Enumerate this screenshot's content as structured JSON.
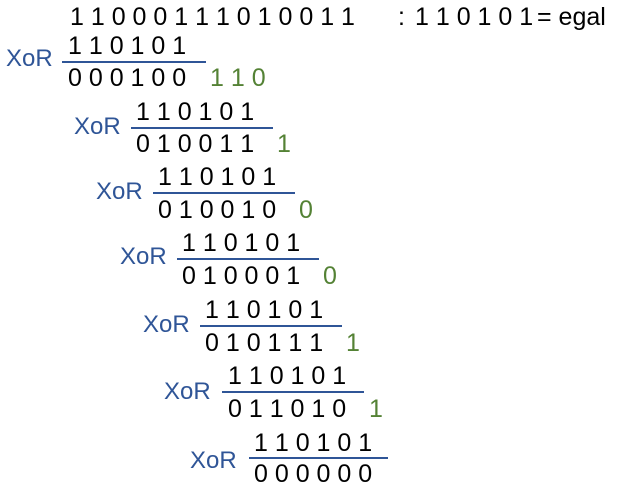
{
  "colors": {
    "xor_label": "#2F5597",
    "divider_line": "#2F5597",
    "brought_down_bits": "#548235",
    "text": "#000000"
  },
  "header": {
    "dividend": "1 1 0 0 0 1 1 1 0 1 0 0 1 1",
    "separator": ":",
    "divisor": "1 1 0 1 0 1",
    "suffix": "= egal"
  },
  "steps": [
    {
      "op": "XoR",
      "subtrahend": "1 1 0 1 0 1",
      "result": "0 0 0 1 0 0",
      "brought_down": "1 1 0"
    },
    {
      "op": "XoR",
      "subtrahend": "1 1 0 1 0 1",
      "result": "0 1 0 0 1 1",
      "brought_down": "1"
    },
    {
      "op": "XoR",
      "subtrahend": "1 1 0 1 0 1",
      "result": "0 1 0 0 1 0",
      "brought_down": "0"
    },
    {
      "op": "XoR",
      "subtrahend": "1 1 0 1 0 1",
      "result": "0 1 0 0 0 1",
      "brought_down": "0"
    },
    {
      "op": "XoR",
      "subtrahend": "1 1 0 1 0 1",
      "result": "0 1 0 1 1 1",
      "brought_down": "1"
    },
    {
      "op": "XoR",
      "subtrahend": "1 1 0 1 0 1",
      "result": "0 1 1 0 1 0",
      "brought_down": "1"
    },
    {
      "op": "XoR",
      "subtrahend": "1 1 0 1 0 1",
      "result": "0 0 0 0 0 0",
      "brought_down": ""
    }
  ]
}
